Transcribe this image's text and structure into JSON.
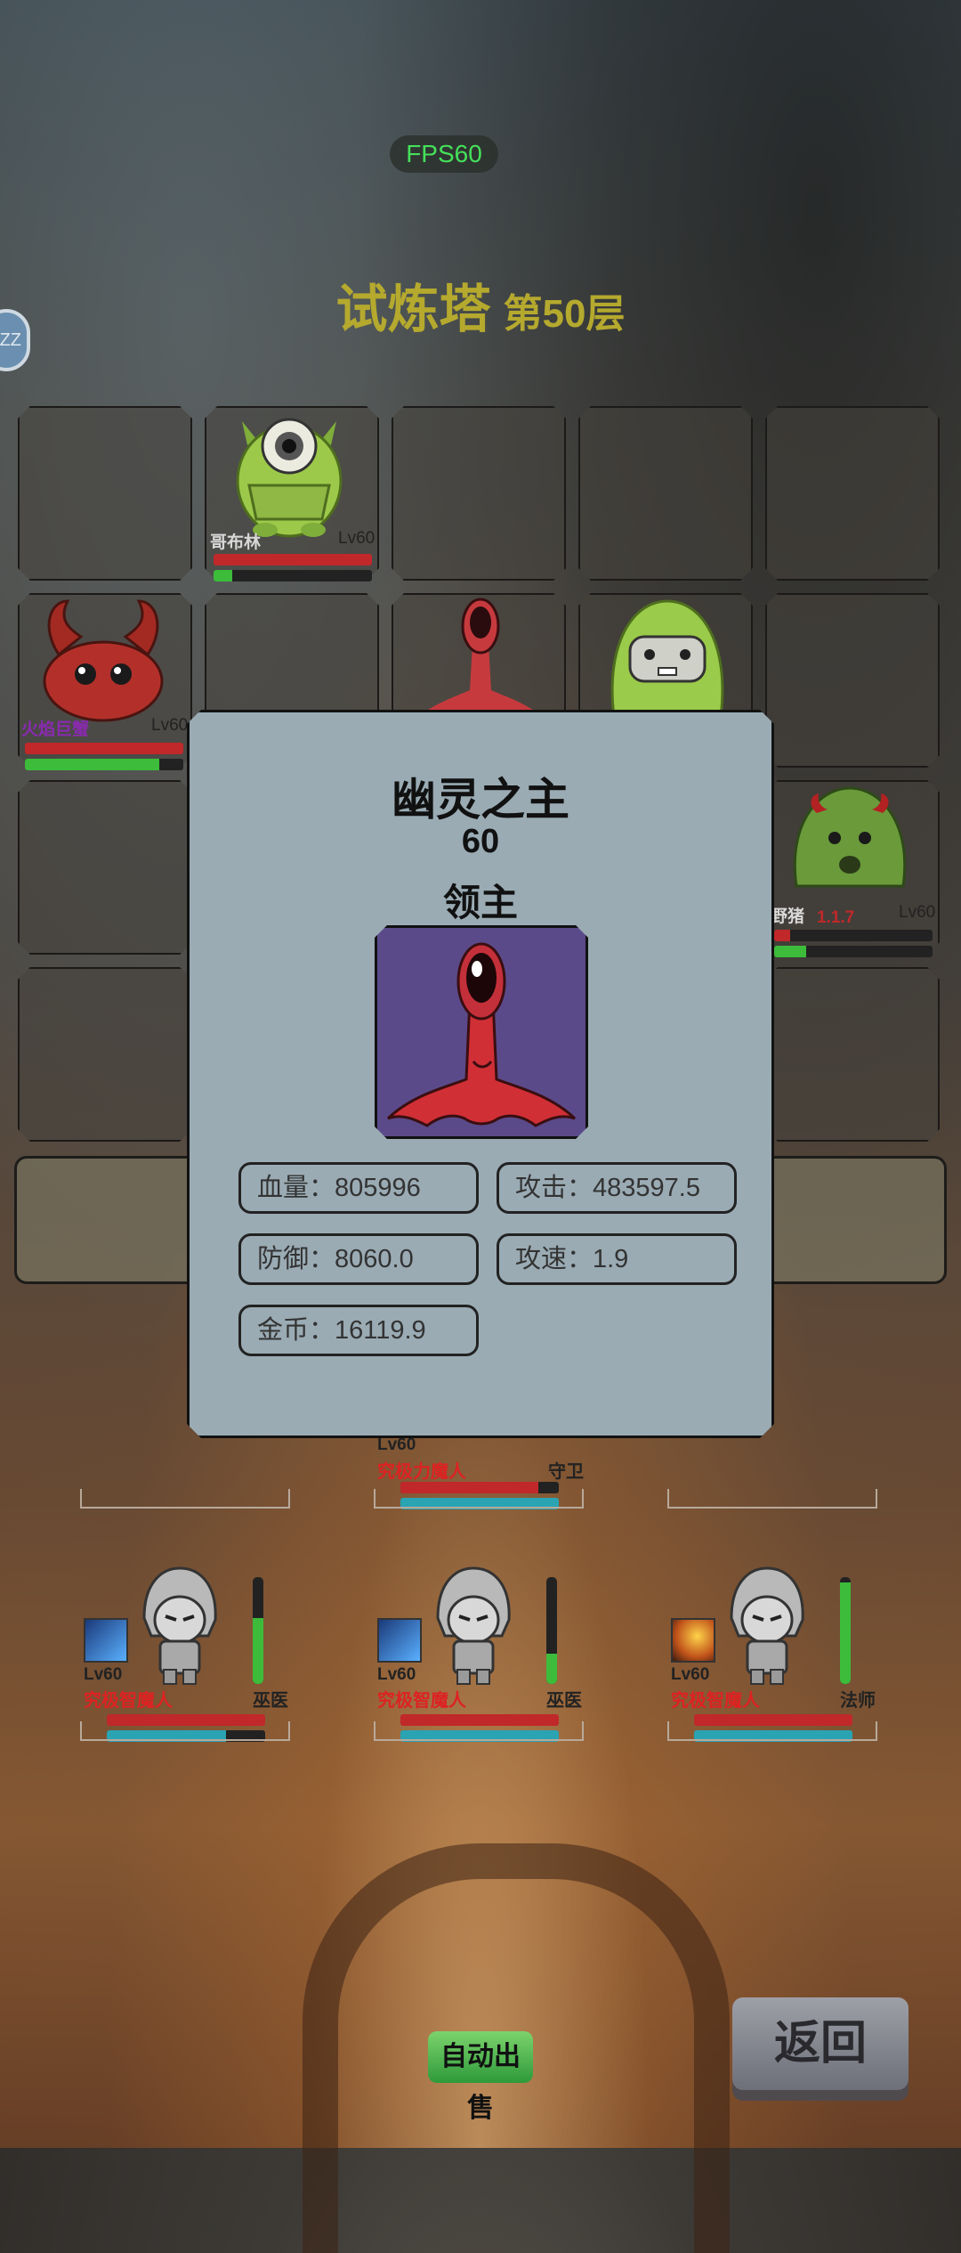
{
  "hud": {
    "fps": "FPS60",
    "status_badge": "ZZ"
  },
  "title": {
    "main": "试炼塔",
    "floor": "第50层"
  },
  "grid_monsters": [
    {
      "name": "哥布林",
      "level": "Lv60",
      "hp": 1.0,
      "energy": 0.12
    },
    {
      "name": "火焰巨蟹",
      "level": "Lv60",
      "hp": 1.0,
      "energy": 0.85
    },
    {
      "name": "野猪",
      "level": "Lv60",
      "hp": 0.1,
      "energy": 0.2,
      "floating_text": "1.1.7"
    }
  ],
  "modal": {
    "name": "幽灵之主",
    "level": "60",
    "rank": "领主",
    "stats": {
      "hp": "血量：805996",
      "attack": "攻击：483597.5",
      "defense": "防御：8060.0",
      "attack_speed": "攻速：1.9",
      "gold": "金币：16119.9"
    }
  },
  "front_hero": {
    "level": "Lv60",
    "name": "究极力魔人",
    "role": "守卫",
    "hp": 0.87,
    "mana": 1.0
  },
  "heroes": [
    {
      "level": "Lv60",
      "name": "究极智魔人",
      "role": "巫医",
      "hp": 1.0,
      "mana": 0.75,
      "energy": 0.62,
      "skill": "ice-comet"
    },
    {
      "level": "Lv60",
      "name": "究极智魔人",
      "role": "巫医",
      "hp": 1.0,
      "mana": 1.0,
      "energy": 0.28,
      "skill": "ice-comet"
    },
    {
      "level": "Lv60",
      "name": "究极智魔人",
      "role": "法师",
      "hp": 1.0,
      "mana": 1.0,
      "energy": 0.95,
      "skill": "fire-meteor"
    }
  ],
  "buttons": {
    "auto_sell": "自动出售",
    "back": "返回"
  },
  "colors": {
    "title": "#b5a92e",
    "hp_red": "#c0282a",
    "energy_green": "#3cbc3a",
    "mana_teal": "#2aa3b3",
    "modal_bg": "#9aabb4"
  }
}
